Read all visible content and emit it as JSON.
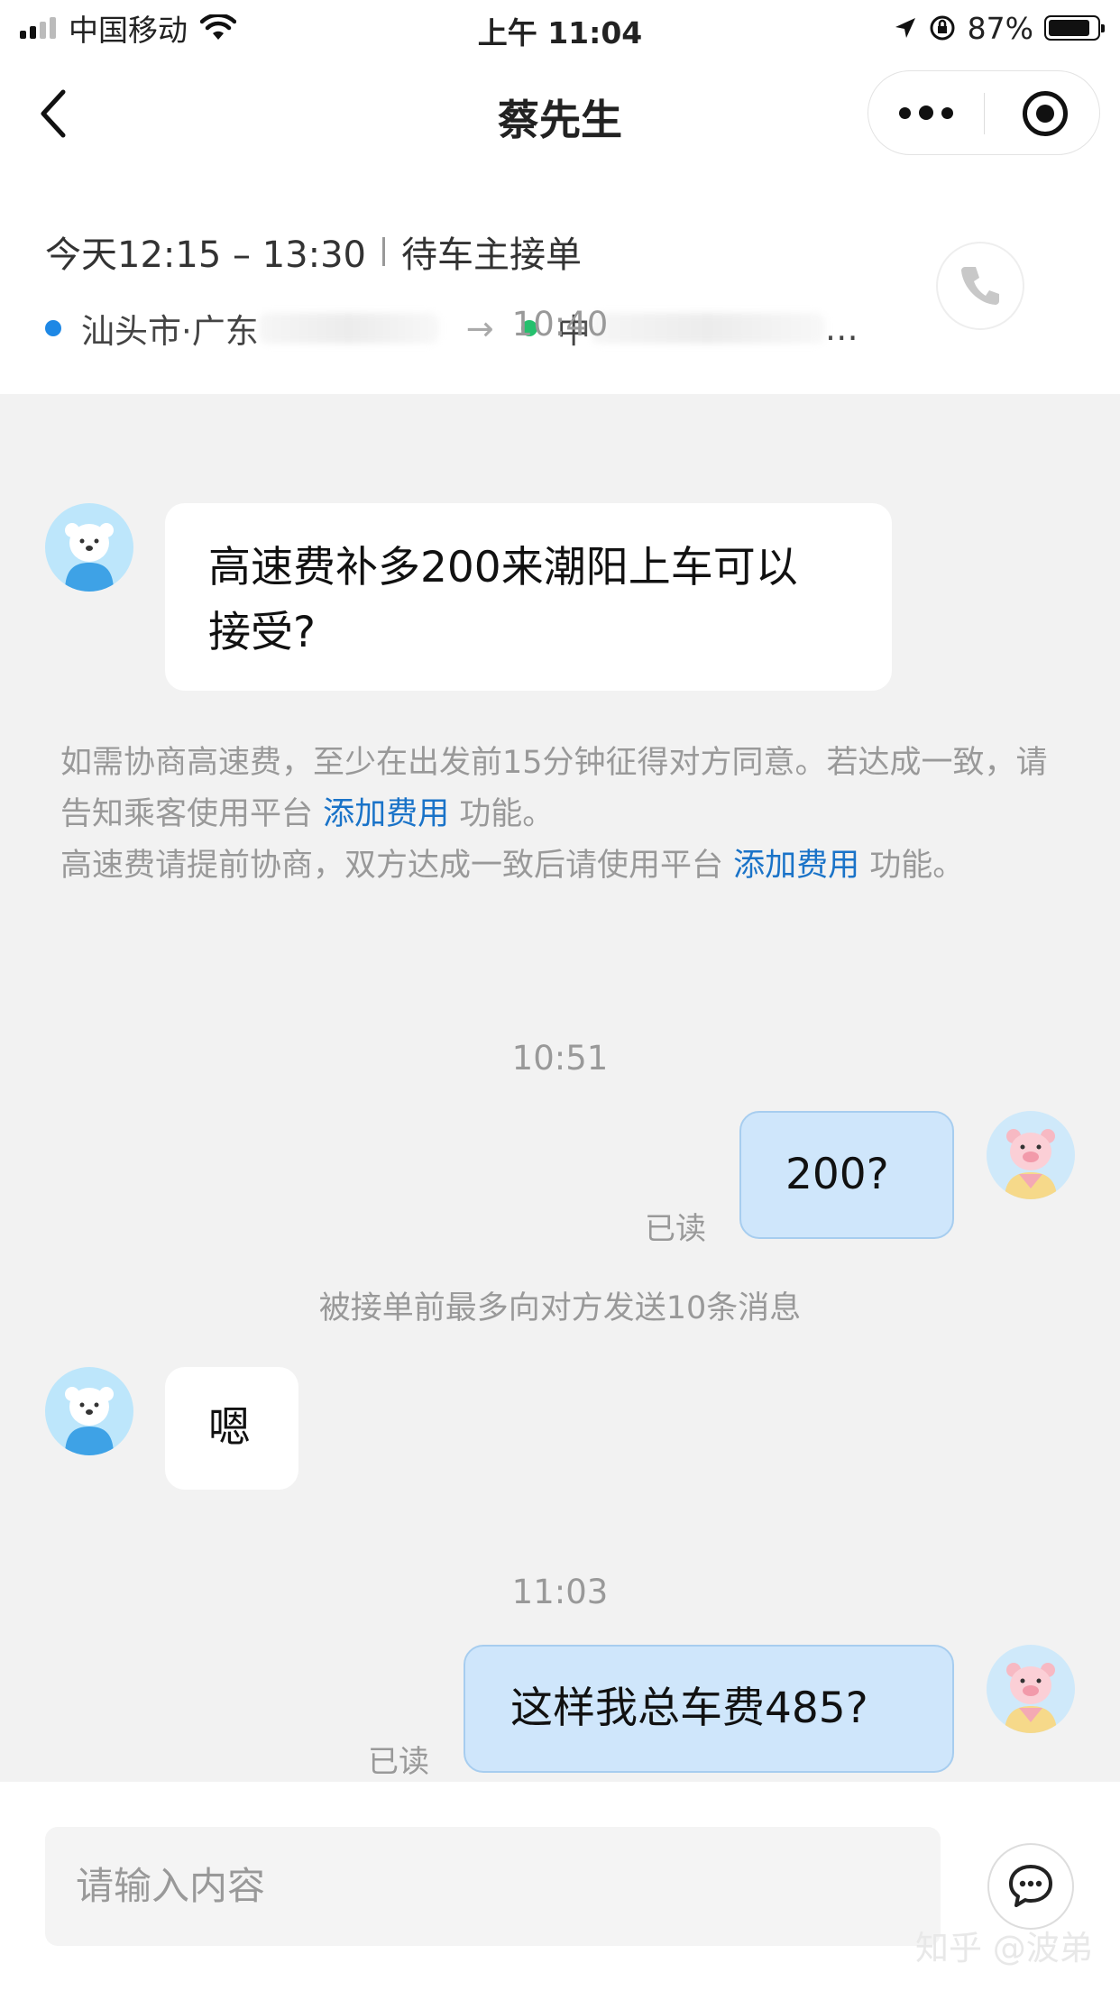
{
  "status_bar": {
    "carrier": "中国移动",
    "time": "上午 11:04",
    "battery": "87%",
    "battery_level": 0.87,
    "icons": [
      "signal-icon",
      "wifi-icon",
      "location-arrow-icon",
      "orientation-lock-icon",
      "battery-icon"
    ]
  },
  "nav": {
    "title": "蔡先生",
    "back_icon": "chevron-left-icon",
    "more_icon": "more-dots-icon",
    "close_icon": "target-circle-icon"
  },
  "trip": {
    "time_range": "今天12:15 – 13:30",
    "status": "待车主接单",
    "from_visible": "汕头市·广东",
    "to_visible": "中",
    "to_tail": "…",
    "arrow": "→",
    "phone_icon": "phone-icon",
    "colors": {
      "from_dot": "#1e88e5",
      "to_dot": "#25c06d"
    }
  },
  "messages": [
    {
      "time": "10:40"
    },
    {
      "side": "in",
      "text_line1": "高速费补多200来潮阳上车可以",
      "text_line2": "接受?"
    },
    {
      "time": "10:51"
    },
    {
      "side": "out",
      "text": "200?",
      "read": "已读"
    },
    {
      "side": "in",
      "text": "嗯"
    },
    {
      "time": "11:03"
    },
    {
      "side": "out",
      "text": "这样我总车费485?",
      "read": "已读"
    }
  ],
  "notice": {
    "part1": "如需协商高速费，至少在出发前15分钟征得对方同意。若达成一致，请告知乘客使用平台 ",
    "link1": "添加费用",
    "part2": " 功能。",
    "part3": "高速费请提前协商，双方达成一致后请使用平台 ",
    "link2": "添加费用",
    "part4": " 功能。"
  },
  "limit_note": "被接单前最多向对方发送10条消息",
  "input": {
    "placeholder": "请输入内容",
    "chat_icon": "chat-bubble-icon"
  },
  "watermark": "知乎 @波弟",
  "colors": {
    "accent_link": "#1a73c8",
    "out_bubble": "#cfe6fb",
    "background": "#f2f2f2"
  }
}
